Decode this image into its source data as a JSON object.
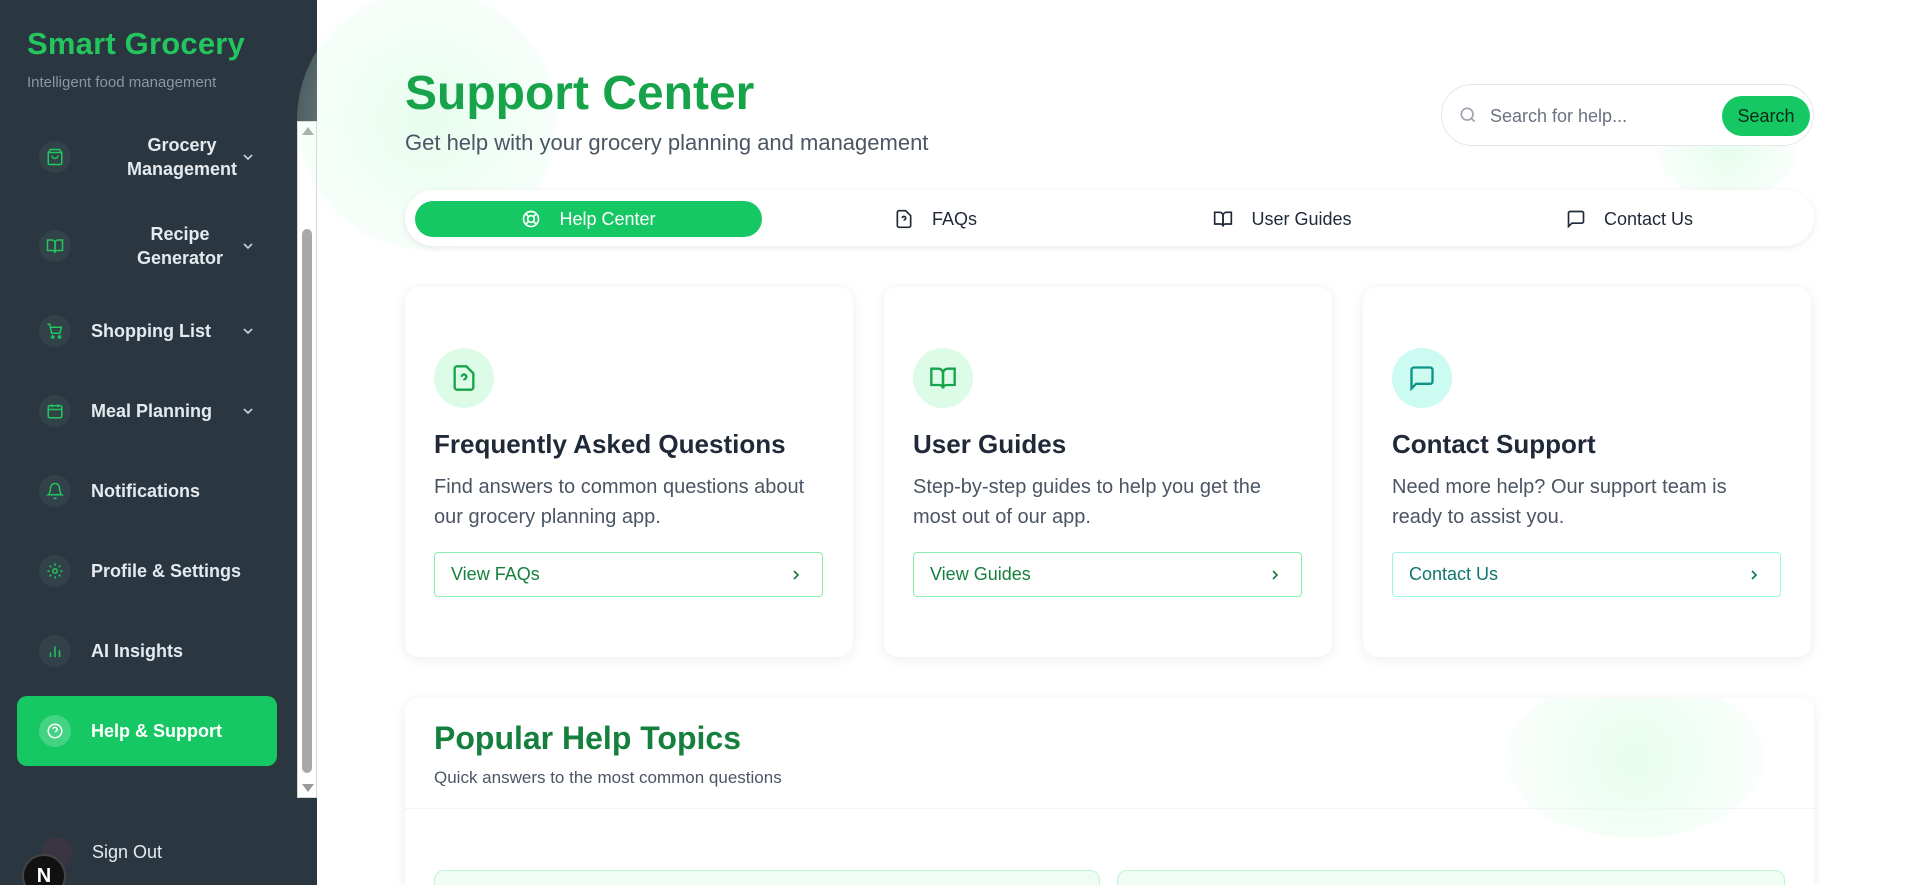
{
  "brand": {
    "title": "Smart Grocery",
    "subtitle": "Intelligent food management"
  },
  "sidebar": {
    "items": [
      {
        "label": "Grocery Management",
        "icon": "shopping-bag-icon",
        "has_chevron": true
      },
      {
        "label": "Recipe Generator",
        "icon": "book-open-icon",
        "has_chevron": true
      },
      {
        "label": "Shopping List",
        "icon": "cart-icon",
        "has_chevron": true
      },
      {
        "label": "Meal Planning",
        "icon": "calendar-icon",
        "has_chevron": true
      },
      {
        "label": "Notifications",
        "icon": "bell-icon",
        "has_chevron": false
      },
      {
        "label": "Profile & Settings",
        "icon": "gear-icon",
        "has_chevron": false
      },
      {
        "label": "AI Insights",
        "icon": "bar-chart-icon",
        "has_chevron": false
      },
      {
        "label": "Help & Support",
        "icon": "help-circle-icon",
        "has_chevron": false,
        "active": true
      }
    ],
    "sign_out": "Sign Out",
    "badge": "N"
  },
  "header": {
    "title": "Support Center",
    "subtitle": "Get help with your grocery planning and management"
  },
  "search": {
    "placeholder": "Search for help...",
    "button": "Search"
  },
  "tabs": [
    {
      "label": "Help Center",
      "icon": "lifebuoy-icon",
      "active": true
    },
    {
      "label": "FAQs",
      "icon": "file-question-icon"
    },
    {
      "label": "User Guides",
      "icon": "book-open-icon"
    },
    {
      "label": "Contact Us",
      "icon": "message-square-icon"
    }
  ],
  "cards": [
    {
      "title": "Frequently Asked Questions",
      "description": "Find answers to common questions about our grocery planning app.",
      "button": "View FAQs",
      "icon": "file-question-icon"
    },
    {
      "title": "User Guides",
      "description": "Step-by-step guides to help you get the most out of our app.",
      "button": "View Guides",
      "icon": "book-open-icon"
    },
    {
      "title": "Contact Support",
      "description": "Need more help? Our support team is ready to assist you.",
      "button": "Contact Us",
      "icon": "message-square-icon"
    }
  ],
  "topics": {
    "title": "Popular Help Topics",
    "subtitle": "Quick answers to the most common questions"
  },
  "colors": {
    "accent": "#16c864",
    "brand_green": "#22c55e",
    "sidebar_bg": "#2a3740",
    "title_green": "#16a34a"
  }
}
